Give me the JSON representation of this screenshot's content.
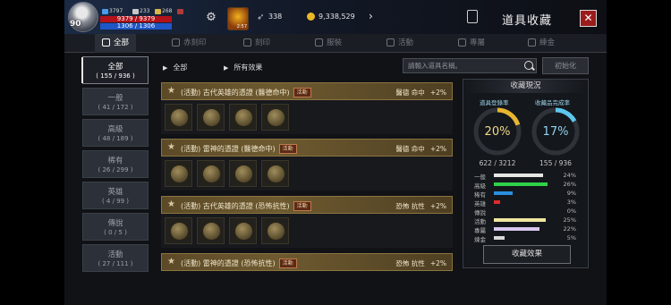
{
  "player": {
    "level": "90",
    "stat1": "3797",
    "stat2": "233",
    "stat3": "268",
    "hp": "9379 / 9379",
    "mp": "1306 / 1306",
    "buff_time": "2:57",
    "silver": "338",
    "gold": "9,338,529"
  },
  "header": {
    "title": "道具收藏"
  },
  "tabs": [
    {
      "label": "全部"
    },
    {
      "label": "赤刻印"
    },
    {
      "label": "刻印"
    },
    {
      "label": "服裝"
    },
    {
      "label": "活動"
    },
    {
      "label": "專屬"
    },
    {
      "label": "練金"
    }
  ],
  "sidebar": {
    "items": [
      {
        "name": "全部",
        "count": "( 155 / 936 )"
      },
      {
        "name": "一般",
        "count": "( 41 / 172 )"
      },
      {
        "name": "高級",
        "count": "( 48 / 189 )"
      },
      {
        "name": "稀有",
        "count": "( 26 / 299 )"
      },
      {
        "name": "英雄",
        "count": "( 4 / 99 )"
      },
      {
        "name": "傳說",
        "count": "( 0 / 5 )"
      },
      {
        "name": "活動",
        "count": "( 27 / 111 )"
      }
    ]
  },
  "filters": {
    "category": "全部",
    "effect": "所有效果",
    "search_placeholder": "請輸入道具名稱。",
    "reset_label": "初始化"
  },
  "collections": [
    {
      "name": "(活動) 古代英雄的憑證 (醫德命中)",
      "badge": "活動",
      "stat": "醫德 命中",
      "value": "+2%"
    },
    {
      "name": "(活動) 雷神的憑證 (醫德命中)",
      "badge": "活動",
      "stat": "醫德 命中",
      "value": "+2%"
    },
    {
      "name": "(活動) 古代英雄的憑證 (恐怖抗性)",
      "badge": "活動",
      "stat": "恐怖 抗性",
      "value": "+2%"
    },
    {
      "name": "(活動) 雷神的憑證 (恐怖抗性)",
      "badge": "活動",
      "stat": "恐怖 抗性",
      "value": "+2%"
    }
  ],
  "status": {
    "title": "收藏現況",
    "register_label": "道具登錄率",
    "complete_label": "收藏品完成率",
    "register_pct": "20%",
    "complete_pct": "17%",
    "register_fraction": 0.2,
    "complete_fraction": 0.17,
    "register_count": "622 / 3212",
    "complete_count": "155 / 936",
    "grades": [
      {
        "name": "一般",
        "pct": "24%",
        "fraction": 0.24,
        "color": "#e6e6e6"
      },
      {
        "name": "高級",
        "pct": "26%",
        "fraction": 0.26,
        "color": "#2fd14a"
      },
      {
        "name": "稀有",
        "pct": "9%",
        "fraction": 0.09,
        "color": "#2a8fe0"
      },
      {
        "name": "英雄",
        "pct": "3%",
        "fraction": 0.03,
        "color": "#e02a2a"
      },
      {
        "name": "傳說",
        "pct": "0%",
        "fraction": 0.0,
        "color": "#c040e0"
      },
      {
        "name": "活動",
        "pct": "25%",
        "fraction": 0.25,
        "color": "#f0e6a0"
      },
      {
        "name": "專屬",
        "pct": "22%",
        "fraction": 0.22,
        "color": "#d8c8f0"
      },
      {
        "name": "煉金",
        "pct": "5%",
        "fraction": 0.05,
        "color": "#d8d8d8"
      }
    ],
    "effect_button": "收藏效果"
  },
  "colors": {
    "register_ring": "#e8b530",
    "complete_ring": "#5ec6ef",
    "card_header": "#6e5a30",
    "close_button": "#9b1c1c"
  },
  "icons": [
    "avatar-portrait",
    "book-icon",
    "close-icon",
    "search-icon",
    "star-icon",
    "medal-icon",
    "feather-icon",
    "gold-coin-icon"
  ]
}
